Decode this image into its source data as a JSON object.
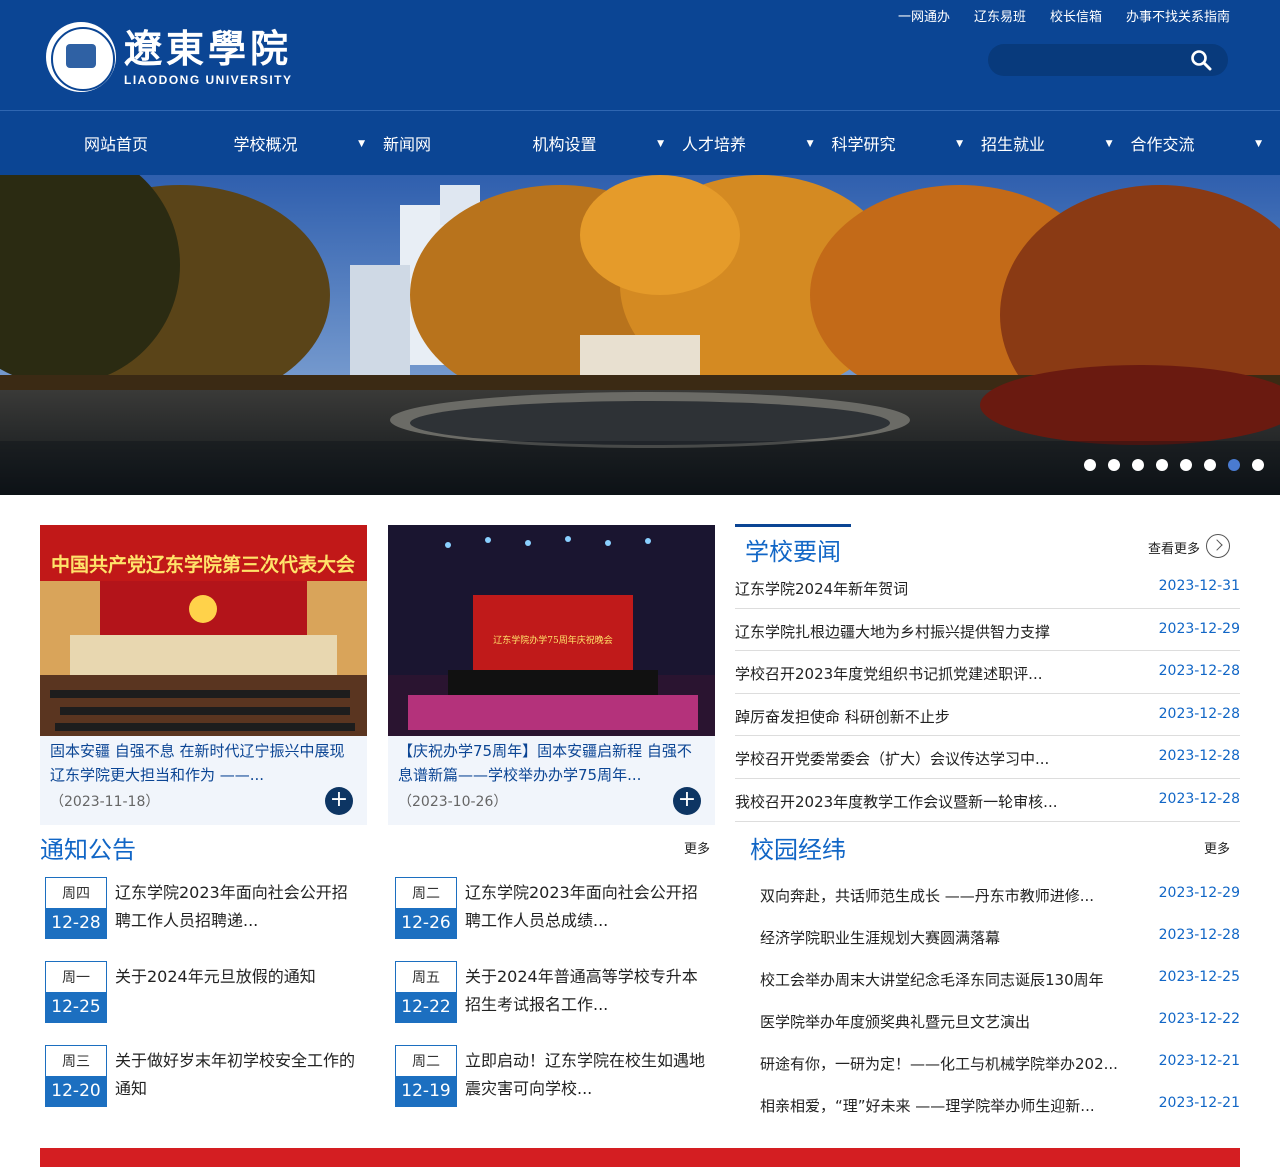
{
  "header": {
    "logo_cn": "遼東學院",
    "logo_en": "LIAODONG UNIVERSITY",
    "top_links": [
      "一网通办",
      "辽东易班",
      "校长信箱",
      "办事不找关系指南"
    ],
    "search_placeholder": ""
  },
  "nav": [
    {
      "label": "网站首页",
      "has_dropdown": false
    },
    {
      "label": "学校概况",
      "has_dropdown": true
    },
    {
      "label": "新闻网",
      "has_dropdown": false
    },
    {
      "label": "机构设置",
      "has_dropdown": true
    },
    {
      "label": "人才培养",
      "has_dropdown": true
    },
    {
      "label": "科学研究",
      "has_dropdown": true
    },
    {
      "label": "招生就业",
      "has_dropdown": true
    },
    {
      "label": "合作交流",
      "has_dropdown": true
    }
  ],
  "banner": {
    "dot_count": 8,
    "active_dot": 7
  },
  "cards": [
    {
      "image_text": "中国共产党辽东学院第三次代表大会",
      "title": "固本安疆 自强不息 在新时代辽宁振兴中展现辽东学院更大担当和作为 ——...",
      "date": "（2023-11-18）"
    },
    {
      "image_text": "辽东学院办学75周年庆祝晚会",
      "title": "【庆祝办学75周年】固本安疆启新程 自强不息谱新篇——学校举办办学75周年...",
      "date": "（2023-10-26）"
    }
  ],
  "news": {
    "title": "学校要闻",
    "more_label": "查看更多",
    "items": [
      {
        "title": "辽东学院2024年新年贺词",
        "date": "2023-12-31"
      },
      {
        "title": "辽东学院扎根边疆大地为乡村振兴提供智力支撑",
        "date": "2023-12-29"
      },
      {
        "title": "学校召开2023年度党组织书记抓党建述职评...",
        "date": "2023-12-28"
      },
      {
        "title": "踔厉奋发担使命 科研创新不止步",
        "date": "2023-12-28"
      },
      {
        "title": "学校召开党委常委会（扩大）会议传达学习中...",
        "date": "2023-12-28"
      },
      {
        "title": "我校召开2023年度教学工作会议暨新一轮审核...",
        "date": "2023-12-28"
      }
    ]
  },
  "notices": {
    "title": "通知公告",
    "more_label": "更多",
    "items": [
      {
        "week": "周四",
        "day": "12-28",
        "title": "辽东学院2023年面向社会公开招聘工作人员招聘递..."
      },
      {
        "week": "周二",
        "day": "12-26",
        "title": "辽东学院2023年面向社会公开招聘工作人员总成绩..."
      },
      {
        "week": "周一",
        "day": "12-25",
        "title": "关于2024年元旦放假的通知"
      },
      {
        "week": "周五",
        "day": "12-22",
        "title": "关于2024年普通高等学校专升本招生考试报名工作..."
      },
      {
        "week": "周三",
        "day": "12-20",
        "title": "关于做好岁末年初学校安全工作的通知"
      },
      {
        "week": "周二",
        "day": "12-19",
        "title": "立即启动！辽东学院在校生如遇地震灾害可向学校..."
      }
    ]
  },
  "campus": {
    "title": "校园经纬",
    "more_label": "更多",
    "items": [
      {
        "title": "双向奔赴，共话师范生成长 ——丹东市教师进修...",
        "date": "2023-12-29"
      },
      {
        "title": "经济学院职业生涯规划大赛圆满落幕",
        "date": "2023-12-28"
      },
      {
        "title": "校工会举办周末大讲堂纪念毛泽东同志诞辰130周年",
        "date": "2023-12-25"
      },
      {
        "title": "医学院举办年度颁奖典礼暨元旦文艺演出",
        "date": "2023-12-22"
      },
      {
        "title": "研途有你，一研为定！——化工与机械学院举办202...",
        "date": "2023-12-21"
      },
      {
        "title": "相亲相爱，“理”好未来 ——理学院举办师生迎新...",
        "date": "2023-12-21"
      }
    ]
  },
  "colors": {
    "brand_blue": "#0b4594",
    "link_blue": "#1166c6",
    "footer_red": "#d41e22"
  }
}
